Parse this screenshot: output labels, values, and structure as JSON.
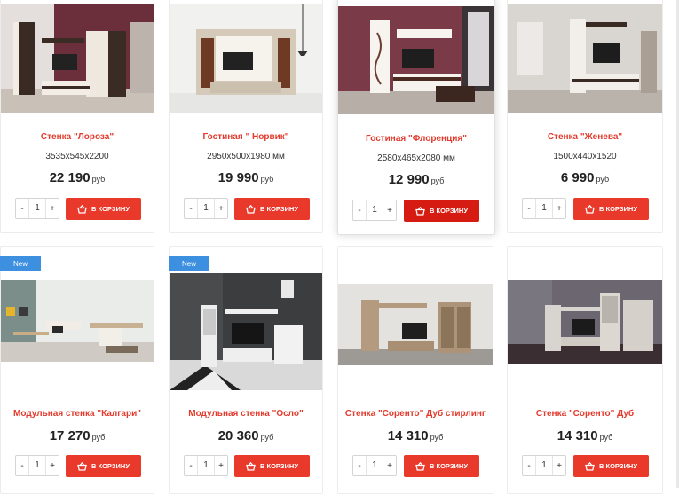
{
  "labels": {
    "cart_button": "В КОРЗИНУ",
    "qty_minus": "-",
    "qty_plus": "+",
    "new_badge": "New"
  },
  "products": [
    {
      "title": "Стенка \"Лороза\"",
      "dims": "3535x545x2200",
      "price": "22 190",
      "currency": "руб",
      "qty": "1"
    },
    {
      "title": "Гостиная \" Норвик\"",
      "dims": "2950x500x1980 мм",
      "price": "19 990",
      "currency": "руб",
      "qty": "1"
    },
    {
      "title": "Гостиная \"Флоренция\"",
      "dims": "2580x465x2080 мм",
      "price": "12 990",
      "currency": "руб",
      "qty": "1"
    },
    {
      "title": "Стенка \"Женева\"",
      "dims": "1500x440x1520",
      "price": "6 990",
      "currency": "руб",
      "qty": "1"
    },
    {
      "title": "Модульная стенка \"Калгари\"",
      "price": "17 270",
      "currency": "руб",
      "qty": "1",
      "badge": "New"
    },
    {
      "title": "Модульная стенка \"Осло\"",
      "price": "20 360",
      "currency": "руб",
      "qty": "1",
      "badge": "New"
    },
    {
      "title": "Стенка \"Соренто\" Дуб стирлинг",
      "price": "14 310",
      "currency": "руб",
      "qty": "1"
    },
    {
      "title": "Стенка \"Соренто\" Дуб",
      "price": "14 310",
      "currency": "руб",
      "qty": "1"
    }
  ]
}
